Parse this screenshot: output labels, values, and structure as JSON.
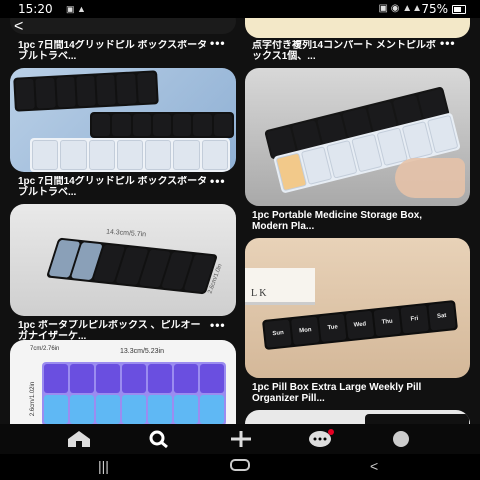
{
  "status": {
    "time": "15:20",
    "battery": "75%"
  },
  "feed": {
    "captions": {
      "top_left": "1pc 7日間14グリッドピル ボックスポータブルトラベ...",
      "top_right": "点字付き複列14コンパート メントピルボックス1個、...",
      "left_2": "1pc 7日間14グリッドピル ボックスポータブルトラベ...",
      "right_2": "1pc Portable Medicine Storage Box, Modern Pla...",
      "left_3": "1pc ポータブルピルボックス 、ピルオーガナイザーケ...",
      "right_3": "1pc Pill Box Extra Large Weekly Pill Organizer Pill..."
    },
    "dimensions": {
      "length_cm_in": "14.3cm/5.7in",
      "width_in": "2.6cm/1.0in",
      "length_2": "13.3cm/5.23in",
      "side_small": "7cm/2.76in",
      "side_v": "2.6cm/1.02in"
    },
    "day_labels": [
      "Sun",
      "Mon",
      "Tue",
      "Wed",
      "Thu",
      "Fri",
      "Sat"
    ],
    "book_text": "L K",
    "more_label": "•••"
  },
  "navbar": {
    "icons": [
      "home-icon",
      "search-icon",
      "plus-icon",
      "chat-icon",
      "profile-icon"
    ]
  },
  "colors": {
    "accent": "#e60023",
    "background": "#000000"
  }
}
